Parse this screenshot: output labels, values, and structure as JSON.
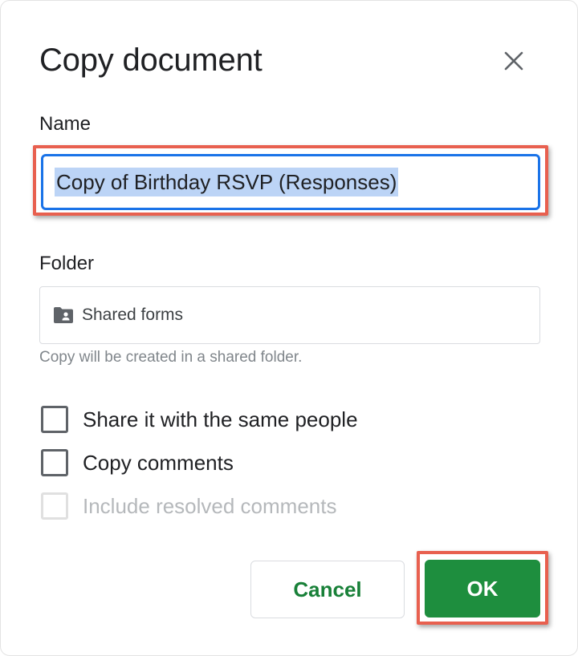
{
  "dialog": {
    "title": "Copy document",
    "close_icon": "close-icon"
  },
  "name_field": {
    "label": "Name",
    "value": "Copy of Birthday RSVP (Responses)"
  },
  "folder_field": {
    "label": "Folder",
    "icon": "shared-folder-icon",
    "value": "Shared forms",
    "hint": "Copy will be created in a shared folder."
  },
  "options": {
    "share": {
      "label": "Share it with the same people",
      "checked": false
    },
    "copy_comments": {
      "label": "Copy comments",
      "checked": false
    },
    "include_resolved": {
      "label": "Include resolved comments",
      "checked": false,
      "disabled": true
    }
  },
  "buttons": {
    "cancel_label": "Cancel",
    "ok_label": "OK"
  },
  "colors": {
    "accent_green": "#1e8e3e",
    "focus_blue": "#1a73e8",
    "highlight_red": "#e8604f"
  }
}
